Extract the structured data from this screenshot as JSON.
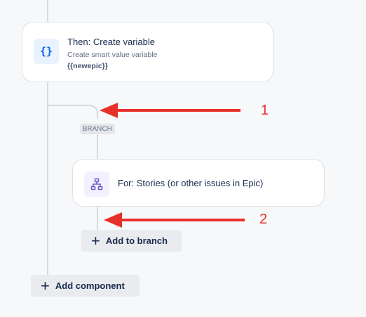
{
  "create_variable_card": {
    "icon": "curly-braces-icon",
    "icon_glyph": "{}",
    "title": "Then: Create variable",
    "subtitle": "Create smart value variable",
    "variable": "{{newepic}}"
  },
  "branch": {
    "badge": "BRANCH"
  },
  "for_card": {
    "icon": "branch-hierarchy-icon",
    "title": "For: Stories (or other issues in Epic)"
  },
  "buttons": {
    "add_to_branch": "Add to branch",
    "add_component": "Add component",
    "plus_glyph": "+"
  },
  "annotations": {
    "arrow_color": "#e8302a",
    "marker_1": "1",
    "marker_2": "2"
  },
  "colors": {
    "background": "#f7f8f9",
    "connector": "#d5d9e0",
    "variable_icon": "#0c66e4",
    "branch_icon": "#6e5dc6"
  }
}
